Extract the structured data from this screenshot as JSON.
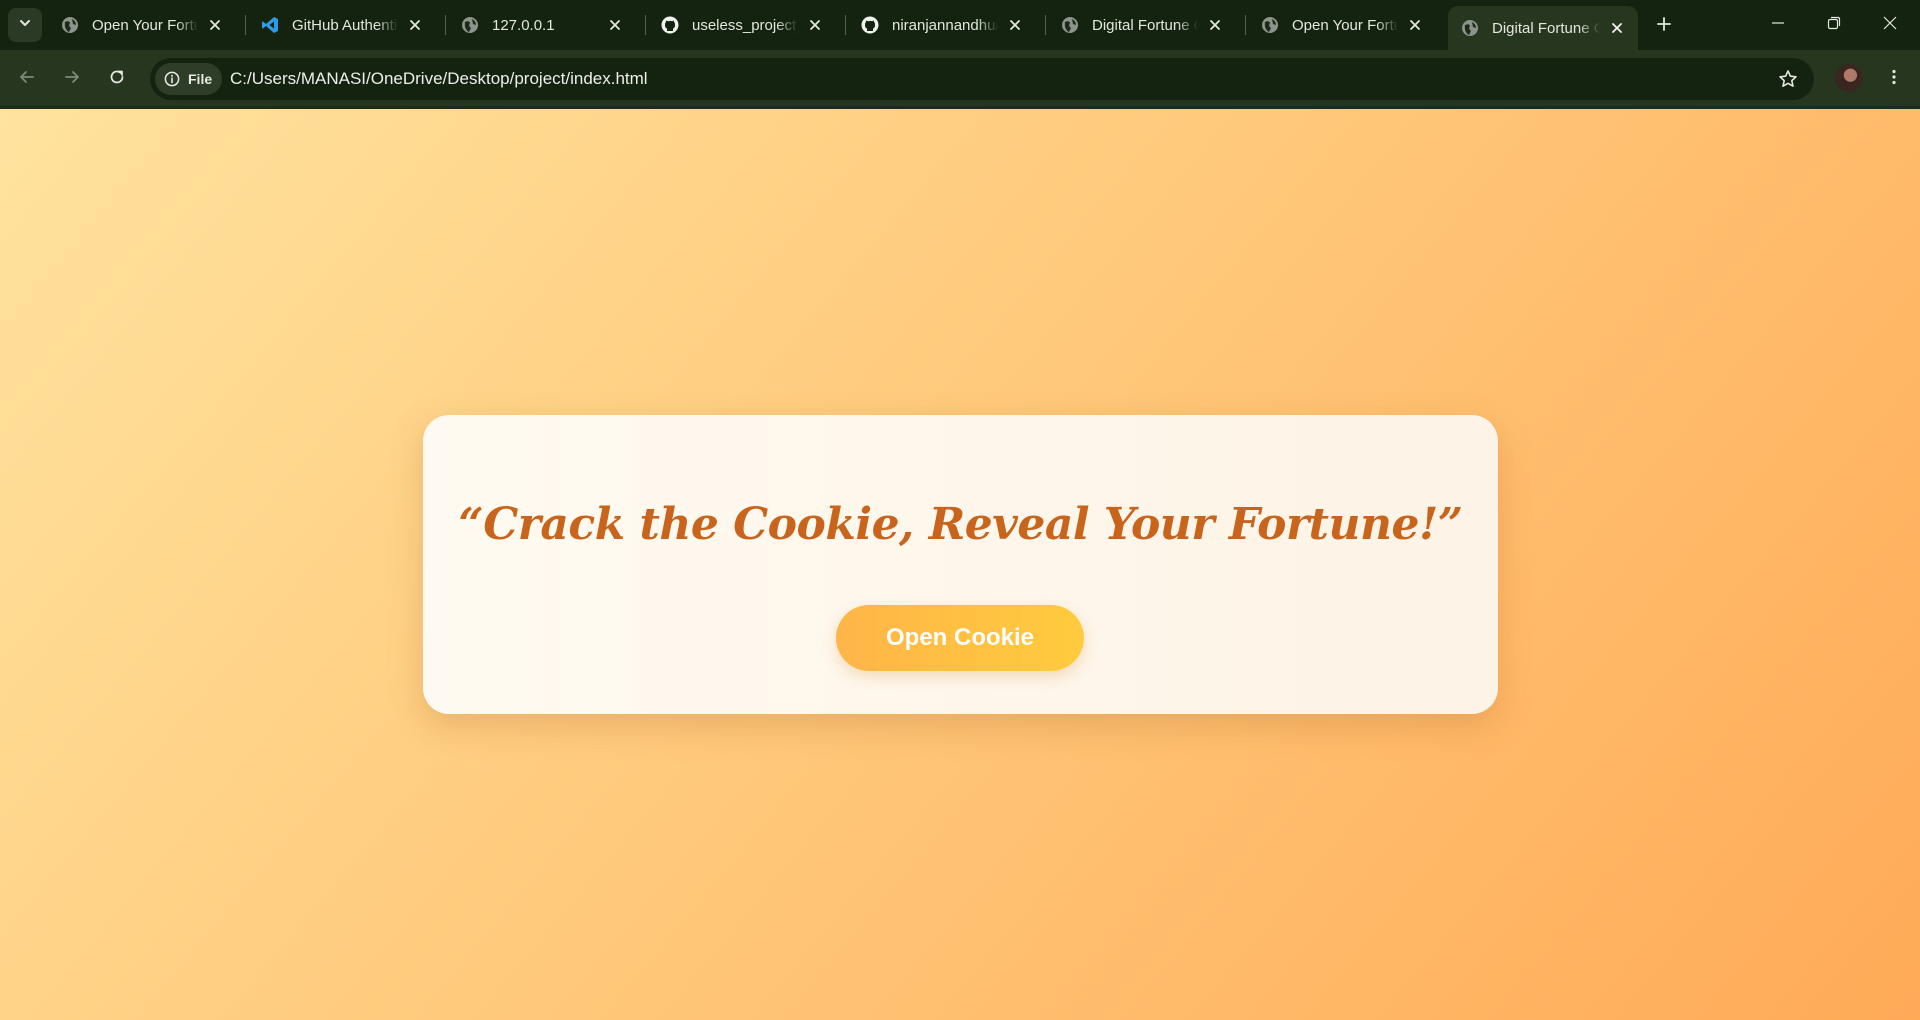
{
  "browser": {
    "tabs": [
      {
        "title": "Open Your Fortune",
        "favicon": "globe-icon",
        "active": false
      },
      {
        "title": "GitHub Authentication",
        "favicon": "vscode-icon",
        "active": false
      },
      {
        "title": "127.0.0.1",
        "favicon": "globe-icon",
        "active": false
      },
      {
        "title": "useless_project_t",
        "favicon": "github-icon",
        "active": false
      },
      {
        "title": "niranjannandhu/",
        "favicon": "github-icon",
        "active": false
      },
      {
        "title": "Digital Fortune C",
        "favicon": "globe-icon",
        "active": false
      },
      {
        "title": "Open Your Fortune",
        "favicon": "globe-icon",
        "active": false
      },
      {
        "title": "Digital Fortune C",
        "favicon": "globe-icon",
        "active": true
      }
    ],
    "site_chip_label": "File",
    "url": "C:/Users/MANASI/OneDrive/Desktop/project/index.html"
  },
  "page": {
    "tagline": "“Crack the Cookie, Reveal Your Fortune!”",
    "open_button_label": "Open Cookie"
  },
  "colors": {
    "accent_text": "#c8641c",
    "button_gradient_start": "#ffb548",
    "button_gradient_end": "#ffcb3d",
    "chrome_dark": "#14230f",
    "chrome_toolbar": "#27361f"
  }
}
